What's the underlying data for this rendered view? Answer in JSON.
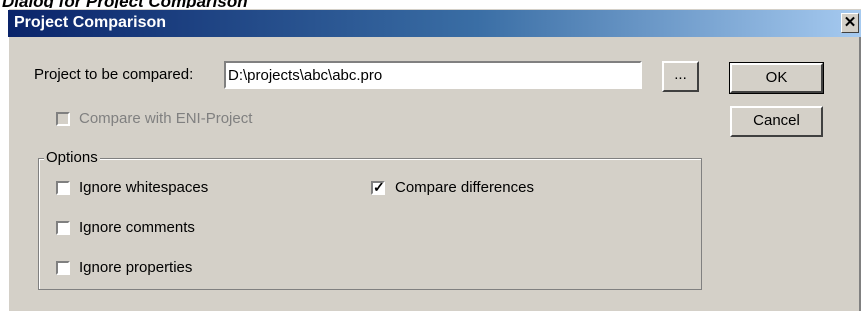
{
  "caption": "Dialog for Project Comparison",
  "dialog": {
    "title": "Project Comparison",
    "close_glyph": "✕",
    "project_label": "Project to be compared:",
    "project_value": "D:\\projects\\abc\\abc.pro",
    "browse_label": "...",
    "ok_label": "OK",
    "cancel_label": "Cancel",
    "eni_label": "Compare with ENI-Project",
    "options_title": "Options",
    "options": {
      "ignore_whitespaces": "Ignore whitespaces",
      "ignore_comments": "Ignore comments",
      "ignore_properties": "Ignore properties",
      "compare_differences": "Compare differences"
    }
  },
  "state": {
    "eni_checked": false,
    "eni_enabled": false,
    "ignore_whitespaces": false,
    "ignore_comments": false,
    "ignore_properties": false,
    "compare_differences": true
  },
  "colors": {
    "dialog_bg": "#d4d0c8",
    "title_start": "#0a246a",
    "title_end": "#a6caf0",
    "disabled_text": "#808080"
  }
}
